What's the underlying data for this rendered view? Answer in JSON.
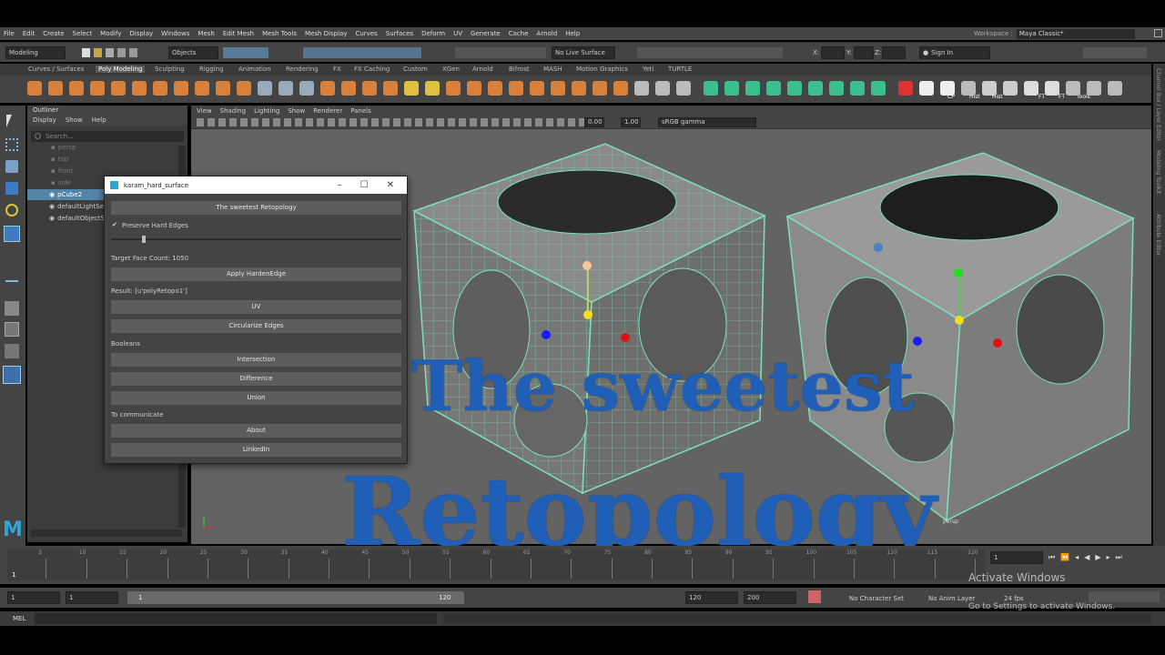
{
  "menu": [
    "File",
    "Edit",
    "Create",
    "Select",
    "Modify",
    "Display",
    "Windows",
    "Mesh",
    "Edit Mesh",
    "Mesh Tools",
    "Mesh Display",
    "Curves",
    "Surfaces",
    "Deform",
    "UV",
    "Generate",
    "Cache",
    "Arnold",
    "Help"
  ],
  "workspace": {
    "label": "Workspace :",
    "value": "Maya Classic*"
  },
  "status": {
    "mode": "Modeling",
    "selection_mode": "Objects",
    "live_surface": "No Live Surface",
    "sign_in": "Sign In",
    "x": "X:",
    "y": "Y:",
    "z": "Z:"
  },
  "shelf_tabs": [
    "Curves / Surfaces",
    "Poly Modeling",
    "Sculpting",
    "Rigging",
    "Animation",
    "Rendering",
    "FX",
    "FX Caching",
    "Custom",
    "XGen",
    "Arnold",
    "Bifrost",
    "MASH",
    "Motion Graphics",
    "Yeti",
    "TURTLE"
  ],
  "shelf_icon_labels": {
    "cp": "CP",
    "hist1": "Hist",
    "hist2": "Hist",
    "ft1": "FT",
    "ft2": "FT",
    "tools": "Tools"
  },
  "outliner": {
    "title": "Outliner",
    "menu": [
      "Display",
      "Show",
      "Help"
    ],
    "search_placeholder": "Search...",
    "items": [
      "persp",
      "top",
      "front",
      "side",
      "pCube2",
      "defaultLightSet",
      "defaultObjectSet"
    ]
  },
  "panel_menu": [
    "View",
    "Shading",
    "Lighting",
    "Show",
    "Renderer",
    "Panels"
  ],
  "panel_tools": {
    "val1": "0.00",
    "val2": "1.00",
    "colorspace": "sRGB gamma"
  },
  "camera_label": "persp",
  "side_tabs": [
    "Channel Box / Layer Editor",
    "Modeling Toolkit",
    "Attribute Editor"
  ],
  "dialog": {
    "title": "karam_hard_surface",
    "btn_retopo": "The sweetest Retopology",
    "chk_hard_edges": "Preserve Hard Edges",
    "target_face": "Target Face Count: 1050",
    "btn_harden": "Apply HardenEdge",
    "result": "Result: [u'polyRetopo1']",
    "btn_uv": "UV",
    "btn_circ": "Circularize Edges",
    "section_booleans": "Booleans",
    "btn_intersection": "Intersection",
    "btn_difference": "Difference",
    "btn_union": "Union",
    "section_comm": "To communicate",
    "btn_about": "About",
    "btn_linkedin": "LinkedIn"
  },
  "overlay": {
    "line1": "The sweetest",
    "line2": "Retopology"
  },
  "timeline": {
    "ticks": [
      "5",
      "10",
      "15",
      "20",
      "25",
      "30",
      "35",
      "40",
      "45",
      "50",
      "55",
      "60",
      "65",
      "70",
      "75",
      "80",
      "85",
      "90",
      "95",
      "100",
      "105",
      "110",
      "115",
      "120"
    ],
    "start_marker": "1",
    "current_frame": "1"
  },
  "range": {
    "start": "1",
    "anim_start": "1",
    "slider_start": "1",
    "slider_end": "120",
    "end": "120",
    "anim_end": "200",
    "fps": "24 fps",
    "char_set": "No Character Set",
    "anim_layer": "No Anim Layer"
  },
  "command": {
    "lang": "MEL"
  },
  "activation": {
    "line1": "Activate Windows",
    "line2": "Go to Settings to activate Windows."
  }
}
